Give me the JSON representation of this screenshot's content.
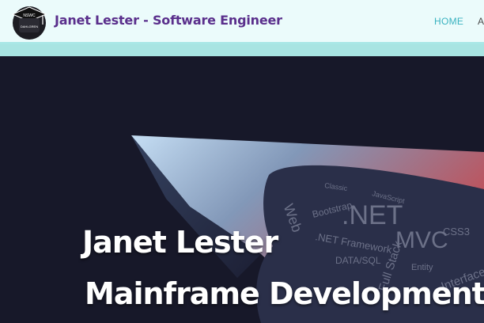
{
  "navbar": {
    "brand": "Janet Lester - Software Engineer",
    "logo_text_top": "NSWC",
    "logo_text_bottom": "DAHLGREN",
    "nav_items": [
      {
        "label": "HOME",
        "color": "#38b2c0"
      },
      {
        "label": "A",
        "color": "#4a4a4a"
      }
    ]
  },
  "hero": {
    "title_line1": "Janet Lester",
    "title_line2": "Mainframe Development",
    "word_cloud": [
      ".NET",
      "MVC",
      "CSS3",
      "Web",
      "Bootstrap",
      ".NET Framework",
      "DATA/SQL",
      "Full Stack",
      "Interface",
      "Classic",
      "JavaScript",
      "Entity"
    ]
  },
  "colors": {
    "brand": "#5a2f8c",
    "nav_bar": "#ebfbfb",
    "nav_shadow": "#a8e4e2",
    "hero_bg": "#171829"
  }
}
